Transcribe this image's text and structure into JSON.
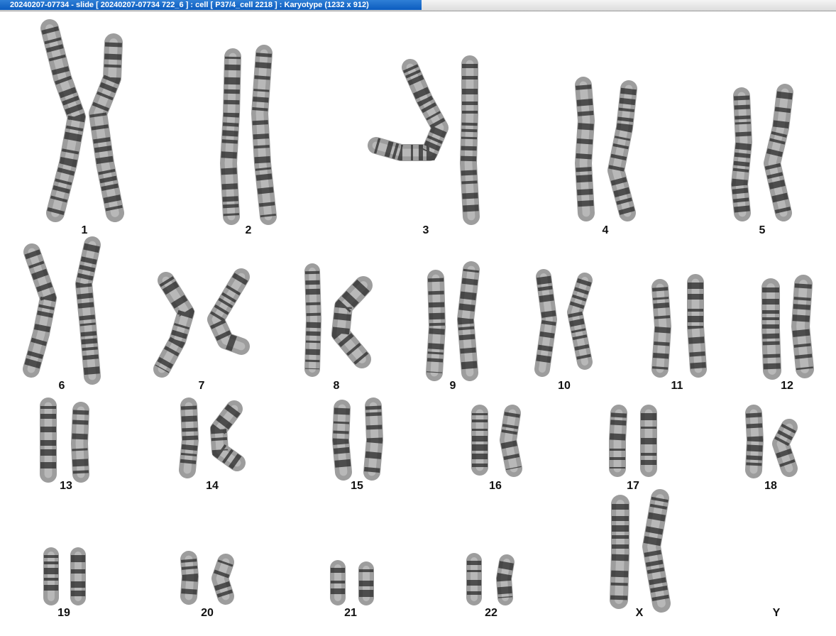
{
  "window": {
    "title": "20240207-07734 - slide [ 20240207-07734 722_6 ] : cell [ P37/4_cell 2218 ] : Karyotype  (1232 x 912)"
  },
  "karyotype": {
    "pairs": [
      {
        "label": "1"
      },
      {
        "label": "2"
      },
      {
        "label": "3"
      },
      {
        "label": "4"
      },
      {
        "label": "5"
      },
      {
        "label": "6"
      },
      {
        "label": "7"
      },
      {
        "label": "8"
      },
      {
        "label": "9"
      },
      {
        "label": "10"
      },
      {
        "label": "11"
      },
      {
        "label": "12"
      },
      {
        "label": "13"
      },
      {
        "label": "14"
      },
      {
        "label": "15"
      },
      {
        "label": "16"
      },
      {
        "label": "17"
      },
      {
        "label": "18"
      },
      {
        "label": "19"
      },
      {
        "label": "20"
      },
      {
        "label": "21"
      },
      {
        "label": "22"
      },
      {
        "label": "X"
      },
      {
        "label": "Y"
      }
    ]
  }
}
